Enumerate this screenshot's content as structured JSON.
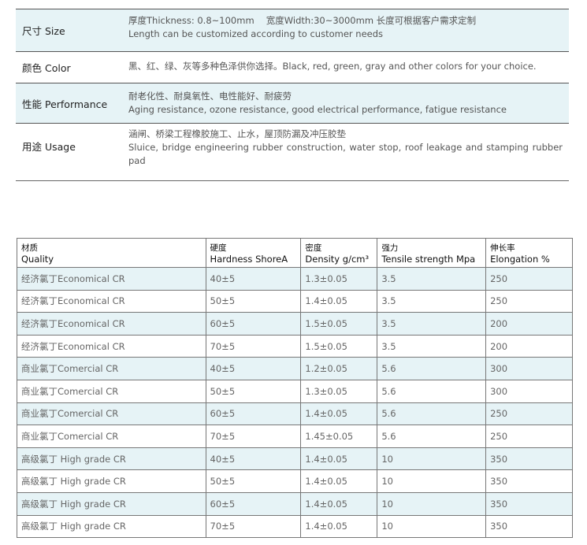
{
  "spec": {
    "size": {
      "label": "尺寸 Size",
      "line1": "厚度Thickness: 0.8~100mm　 宽度Width:30~3000mm  长度可根据客户需求定制",
      "line2": "Length can be customized according to customer needs"
    },
    "color": {
      "label": "颜色 Color",
      "line1": "黑、红、绿、灰等多种色泽供你选择。Black, red, green, gray and other colors for your choice."
    },
    "performance": {
      "label": "性能 Performance",
      "line1": "耐老化性、耐臭氧性、电性能好、耐疲劳",
      "line2": "Aging resistance, ozone resistance, good electrical performance, fatigue resistance"
    },
    "usage": {
      "label": "用途 Usage",
      "line1": "涵闸、桥梁工程橡胶施工、止水，屋顶防漏及冲压胶垫",
      "line2": "Sluice, bridge engineering rubber construction, water stop, roof leakage and stamping rubber pad"
    }
  },
  "table": {
    "headers": [
      {
        "zh": "材质",
        "en": "Quality"
      },
      {
        "zh": "硬度",
        "en": "Hardness ShoreA"
      },
      {
        "zh": "密度",
        "en": "Density g/cm³"
      },
      {
        "zh": "强力",
        "en": "Tensile strength Mpa"
      },
      {
        "zh": "伸长率",
        "en": "Elongation %"
      }
    ],
    "rows": [
      {
        "quality": "经济氯丁Economical CR",
        "hardness": "40±5",
        "density": "1.3±0.05",
        "tensile": "3.5",
        "elongation": "250"
      },
      {
        "quality": "经济氯丁Economical CR",
        "hardness": "50±5",
        "density": "1.4±0.05",
        "tensile": "3.5",
        "elongation": "250"
      },
      {
        "quality": "经济氯丁Economical CR",
        "hardness": "60±5",
        "density": "1.5±0.05",
        "tensile": "3.5",
        "elongation": "200"
      },
      {
        "quality": "经济氯丁Economical CR",
        "hardness": "70±5",
        "density": "1.5±0.05",
        "tensile": "3.5",
        "elongation": "200"
      },
      {
        "quality": "商业氯丁Comercial  CR",
        "hardness": "40±5",
        "density": "1.2±0.05",
        "tensile": "5.6",
        "elongation": "300"
      },
      {
        "quality": "商业氯丁Comercial  CR",
        "hardness": "50±5",
        "density": "1.3±0.05",
        "tensile": "5.6",
        "elongation": "300"
      },
      {
        "quality": "商业氯丁Comercial  CR",
        "hardness": "60±5",
        "density": "1.4±0.05",
        "tensile": "5.6",
        "elongation": "250"
      },
      {
        "quality": "商业氯丁Comercial  CR",
        "hardness": "70±5",
        "density": "1.45±0.05",
        "tensile": "5.6",
        "elongation": "250"
      },
      {
        "quality": "高级氯丁 High grade CR",
        "hardness": "40±5",
        "density": "1.4±0.05",
        "tensile": "10",
        "elongation": "350"
      },
      {
        "quality": "高级氯丁 High grade CR",
        "hardness": "50±5",
        "density": "1.4±0.05",
        "tensile": "10",
        "elongation": "350"
      },
      {
        "quality": "高级氯丁 High grade CR",
        "hardness": "60±5",
        "density": "1.4±0.05",
        "tensile": "10",
        "elongation": "350"
      },
      {
        "quality": "高级氯丁 High grade CR",
        "hardness": "70±5",
        "density": "1.4±0.05",
        "tensile": "10",
        "elongation": "350"
      }
    ]
  }
}
